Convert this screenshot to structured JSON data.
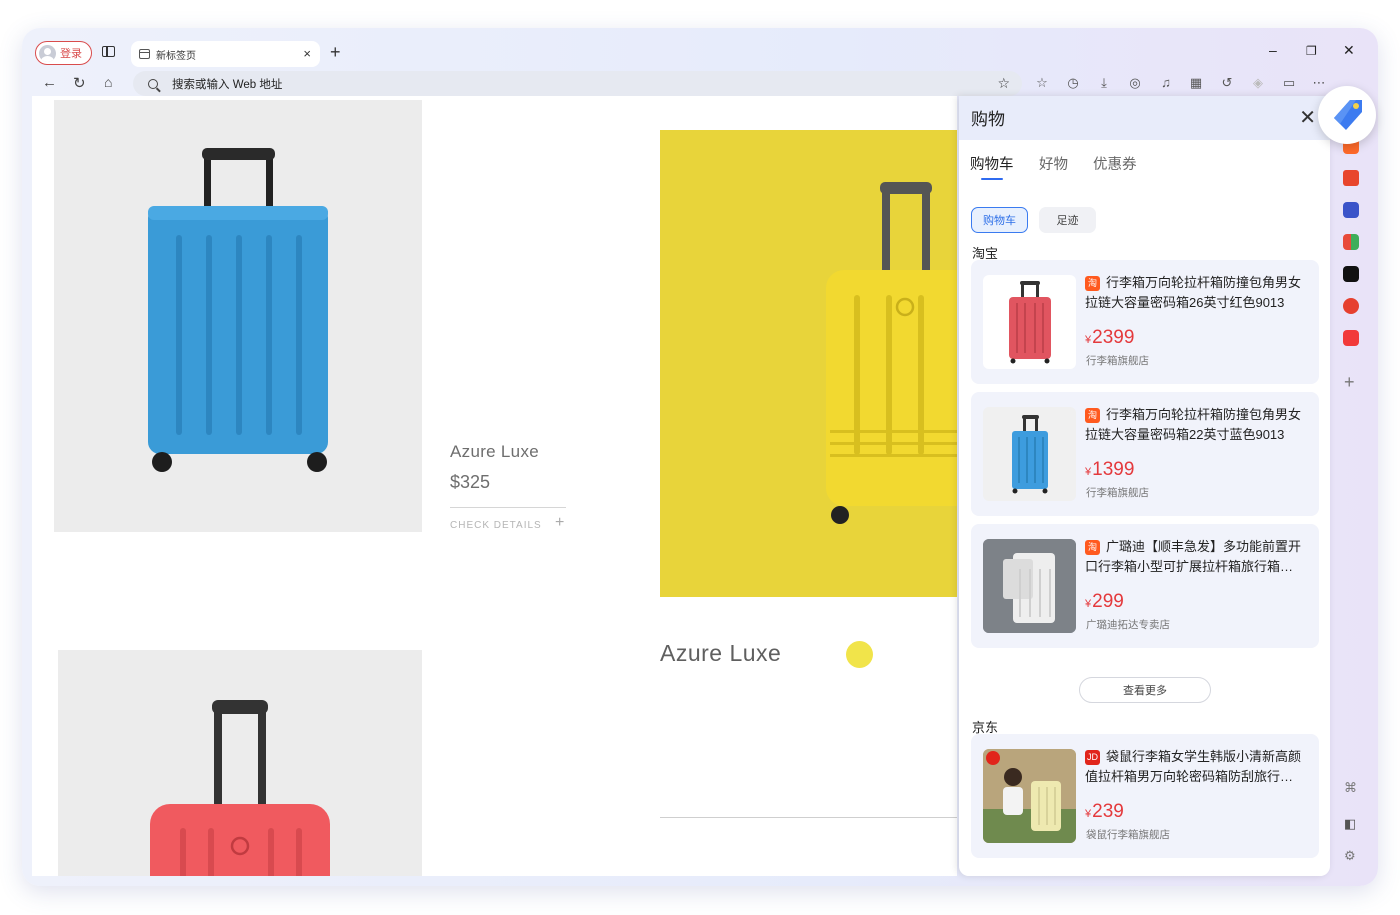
{
  "browser": {
    "login_label": "登录",
    "tab_title": "新标签页",
    "tab_close": "×",
    "new_tab": "+",
    "minimize": "–",
    "restore": "❐",
    "close": "✕",
    "address_placeholder": "搜索或输入 Web 地址"
  },
  "page": {
    "product_name": "Azure Luxe",
    "product_price": "$325",
    "check_details": "CHECK DETAILS",
    "check_plus": "+",
    "featured_name": "Azure Luxe"
  },
  "panel": {
    "title": "购物",
    "close": "✕",
    "tabs": [
      "购物车",
      "好物",
      "优惠券"
    ],
    "chips": [
      "购物车",
      "足迹"
    ],
    "section_taobao": "淘宝",
    "section_jd": "京东",
    "more": "查看更多",
    "taobao_badge": "淘",
    "jd_badge": "JD",
    "currency": "¥",
    "items": [
      {
        "title": "行李箱万向轮拉杆箱防撞包角男女拉链大容量密码箱26英寸红色9013",
        "price": "2399",
        "shop": "行李箱旗舰店",
        "color": "#e15560"
      },
      {
        "title": "行李箱万向轮拉杆箱防撞包角男女拉链大容量密码箱22英寸蓝色9013",
        "price": "1399",
        "shop": "行李箱旗舰店",
        "color": "#3d9cde"
      },
      {
        "title": "广璐迪【顺丰急发】多功能前置开口行李箱小型可扩展拉杆箱旅行箱…",
        "price": "299",
        "shop": "广璐迪拓达专卖店",
        "color": "#d9d9d9"
      }
    ],
    "jd_item": {
      "title": "袋鼠行李箱女学生韩版小清新高颜值拉杆箱男万向轮密码箱防刮旅行…",
      "price": "239",
      "shop": "袋鼠行李箱旗舰店",
      "color": "#eee9b0"
    }
  },
  "colors": {
    "accent": "#2f6bf0",
    "price": "#e4393c",
    "login": "#d94c4c"
  }
}
